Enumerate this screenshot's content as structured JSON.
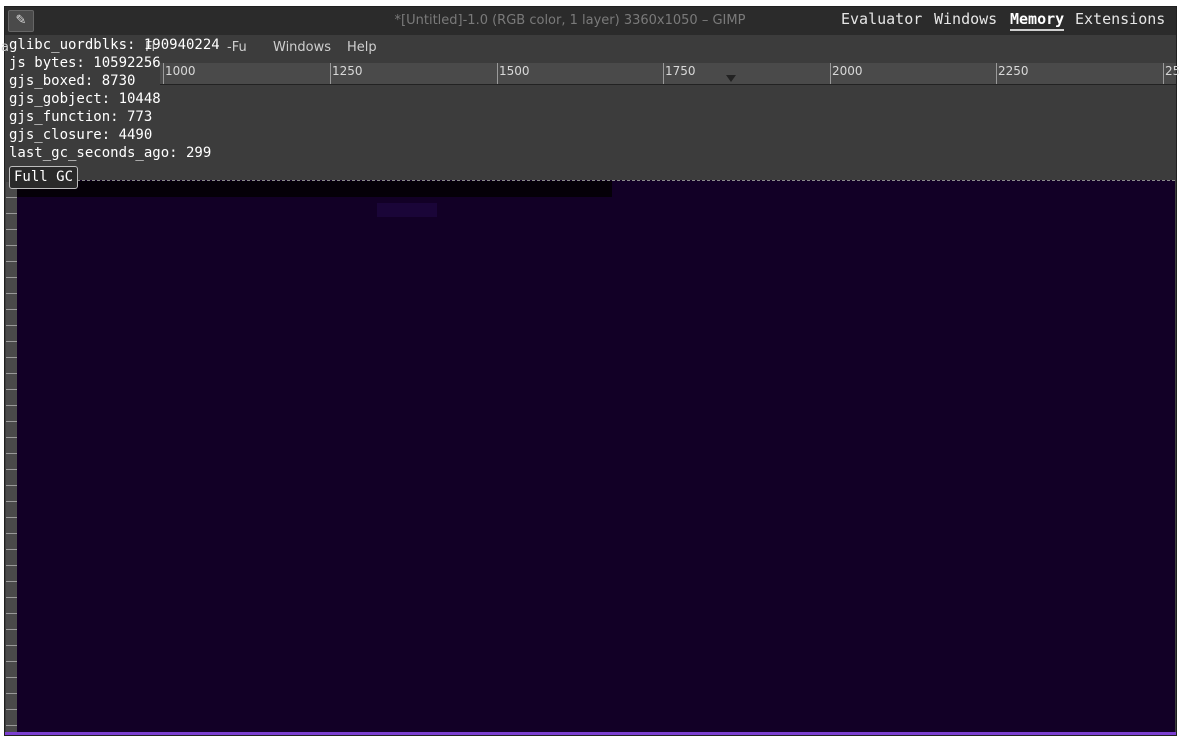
{
  "window": {
    "title": "*[Untitled]-1.0 (RGB color, 1 layer) 3360x1050 – GIMP",
    "icon": "eyedropper-icon"
  },
  "menu": {
    "items": [
      "a",
      "Fi",
      "-Fu",
      "Windows",
      "Help"
    ]
  },
  "ruler": {
    "labels": [
      "1000",
      "1250",
      "1500",
      "1750",
      "2000",
      "2250",
      "25"
    ]
  },
  "looking_glass": {
    "tabs": [
      "Evaluator",
      "Windows",
      "Memory",
      "Extensions"
    ],
    "active_tab": "Memory",
    "memory": [
      "glibc_uordblks: 190940224",
      "js bytes: 10592256",
      "gjs_boxed: 8730",
      "gjs_gobject: 10448",
      "gjs_function: 773",
      "gjs_closure: 4490",
      "last_gc_seconds_ago: 299"
    ],
    "gc_button_label": "Full GC"
  },
  "colors": {
    "canvas": "#120026",
    "accent_line": "#7b3fd0"
  }
}
